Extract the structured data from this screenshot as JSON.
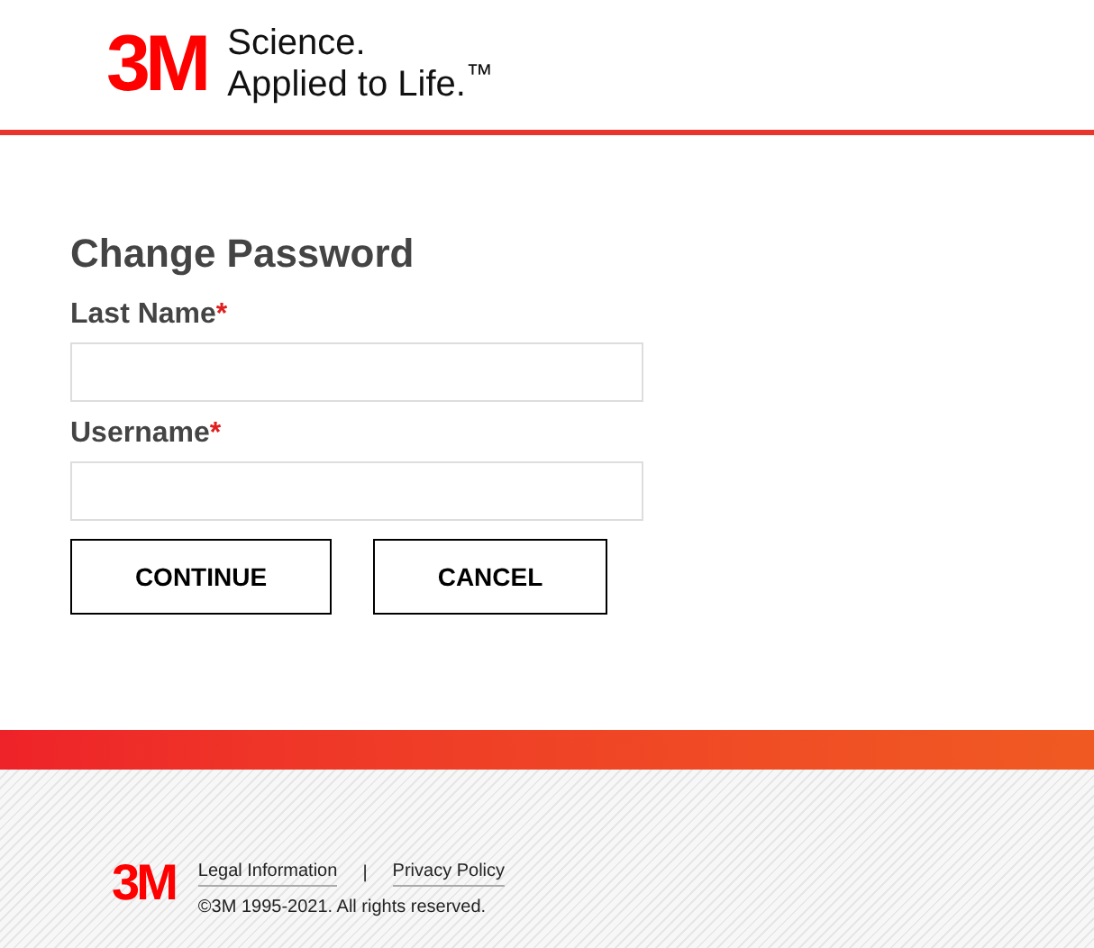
{
  "header": {
    "logo": "3M",
    "tagline_1": "Science.",
    "tagline_2": "Applied to Life.$^{™}$"
  },
  "form": {
    "title": "Change Password",
    "fields": [
      {
        "label": "Last Name",
        "marker": "*"
      },
      {
        "label": "Username",
        "marker": "*"
      }
    ],
    "buttons": [
      "CONTINUE",
      "CANCEL"
    ]
  },
  "footer": {
    "logo": "3M",
    "links": [
      "Legal Information",
      "Privacy Policy"
    ],
    "separator": "|",
    "copyright": "©3M 1995-2021. All rights reserved."
  }
}
